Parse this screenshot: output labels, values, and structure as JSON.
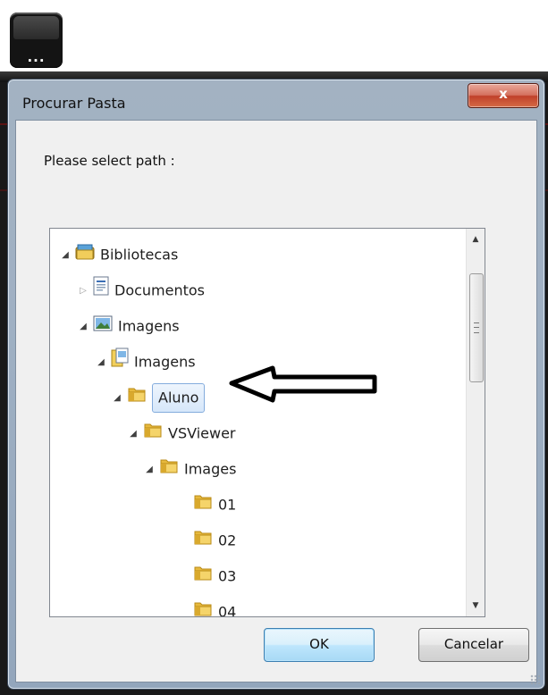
{
  "launcher": {
    "label": "..."
  },
  "dialog": {
    "title": "Procurar Pasta",
    "close_label": "x",
    "prompt": "Please select path :",
    "tree": [
      {
        "label": "Bibliotecas",
        "icon": "libraries-icon",
        "state": "expanded"
      },
      {
        "label": "Documentos",
        "icon": "documents-library-icon",
        "state": "collapsed"
      },
      {
        "label": "Imagens",
        "icon": "pictures-library-icon",
        "state": "expanded"
      },
      {
        "label": "Imagens",
        "icon": "pictures-folder-icon",
        "state": "expanded"
      },
      {
        "label": "Aluno",
        "icon": "folder-icon",
        "state": "expanded",
        "selected": true
      },
      {
        "label": "VSViewer",
        "icon": "folder-icon",
        "state": "expanded"
      },
      {
        "label": "Images",
        "icon": "folder-icon",
        "state": "expanded"
      },
      {
        "label": "01",
        "icon": "folder-icon",
        "state": "leaf"
      },
      {
        "label": "02",
        "icon": "folder-icon",
        "state": "leaf"
      },
      {
        "label": "03",
        "icon": "folder-icon",
        "state": "leaf"
      },
      {
        "label": "04",
        "icon": "folder-icon",
        "state": "leaf"
      }
    ],
    "buttons": {
      "ok": "OK",
      "cancel": "Cancelar"
    }
  },
  "colors": {
    "frame": "#9fb0c3",
    "close_red": "#c0412a",
    "selection": "#d6e7fa",
    "folder_yellow": "#f2cf5b",
    "app_background": "#191919"
  }
}
